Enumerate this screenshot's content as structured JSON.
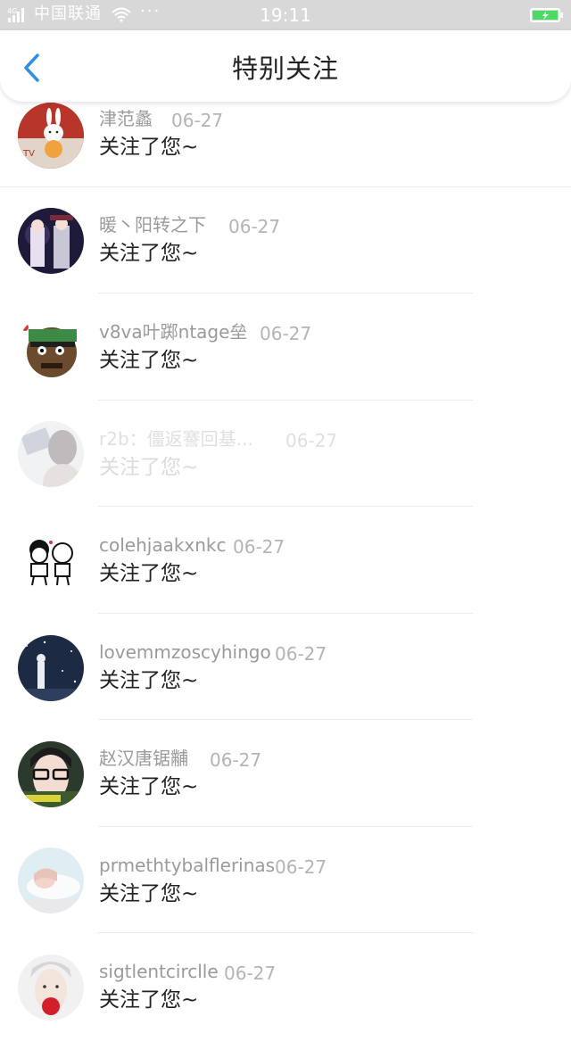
{
  "status_bar": {
    "carrier": "中国联通",
    "dots": "···",
    "time": "19:11"
  },
  "header": {
    "title": "特别关注"
  },
  "items": [
    {
      "name": "津范蠡",
      "date": "06-27",
      "message": "关注了您~"
    },
    {
      "name": "暖丶阳转之下",
      "date": "06-27",
      "message": "关注了您~"
    },
    {
      "name": "v8va叶踯ntage垒",
      "date": "06-27",
      "message": "关注了您~"
    },
    {
      "name": "r2b：僵返謇回基...",
      "date": "06-27",
      "message": "关注了您~"
    },
    {
      "name": "colehjaakxnkc",
      "date": "06-27",
      "message": "关注了您~"
    },
    {
      "name": "lovemmzoscyhingo",
      "date": "06-27",
      "message": "关注了您~"
    },
    {
      "name": "赵汉唐锯黼",
      "date": "06-27",
      "message": "关注了您~"
    },
    {
      "name": "prmethtybalflerinas",
      "date": "06-27",
      "message": "关注了您~"
    },
    {
      "name": "sigtlentcirclle",
      "date": "06-27",
      "message": "关注了您~"
    }
  ],
  "colors": {
    "accent": "#2f8fe0",
    "status_bar_bg": "#d8d8d8",
    "battery": "#4cd964"
  }
}
